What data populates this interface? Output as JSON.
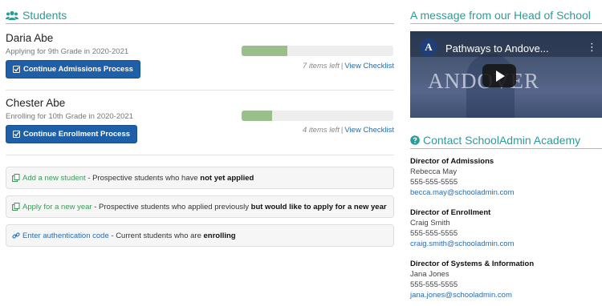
{
  "students_section": {
    "title": "Students",
    "icon": "users-icon"
  },
  "students": [
    {
      "name": "Daria Abe",
      "subtitle": "Applying for 9th Grade in 2020-2021",
      "button_label": "Continue Admissions Process",
      "progress_fraction": 0.3,
      "items_left": "7 items left",
      "separator": "|",
      "checklist_link": "View Checklist"
    },
    {
      "name": "Chester Abe",
      "subtitle": "Enrolling for 10th Grade in 2020-2021",
      "button_label": "Continue Enrollment Process",
      "progress_fraction": 0.2,
      "items_left": "4 items left",
      "separator": "|",
      "checklist_link": "View Checklist"
    }
  ],
  "options": [
    {
      "link": "Add a new student",
      "rest": " - Prospective students who have ",
      "bold": "not yet applied",
      "icon": "copy-icon"
    },
    {
      "link": "Apply for a new year",
      "rest": " - Prospective students who applied previously ",
      "bold": "but would like to apply for a new year",
      "icon": "copy-icon"
    },
    {
      "link": "Enter authentication code",
      "rest": " - Current students who are ",
      "bold": "enrolling",
      "icon": "link-icon"
    }
  ],
  "head_message": {
    "title": "A message from our Head of School",
    "video_title": "Pathways to Andove...",
    "video_logo": "A",
    "video_overlay_text": "ANDOVER",
    "video_menu": "⋮"
  },
  "contact": {
    "title": "Contact SchoolAdmin Academy",
    "icon": "question-circle-icon",
    "people": [
      {
        "role": "Director of Admissions",
        "name": "Rebecca May",
        "phone": "555-555-5555",
        "email": "becca.may@schooladmin.com"
      },
      {
        "role": "Director of Enrollment",
        "name": "Craig Smith",
        "phone": "555-555-5555",
        "email": "craig.smith@schooladmin.com"
      },
      {
        "role": "Director of Systems & Information",
        "name": "Jana Jones",
        "phone": "555-555-5555",
        "email": "jana.jones@schooladmin.com"
      }
    ]
  },
  "colors": {
    "accent": "#2a9d9a",
    "button": "#1f5fa8",
    "progress": "#9bbf8a",
    "link": "#2a6cb0",
    "option_link": "#3a9a5a"
  }
}
